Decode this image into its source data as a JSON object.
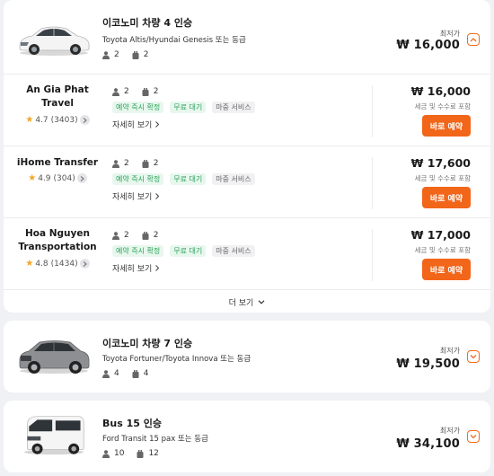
{
  "colors": {
    "accent": "#f2661a",
    "tag_green": "#2aa35a",
    "star": "#f5a623"
  },
  "vehicles": [
    {
      "title": "이코노미 차량 4 인승",
      "models": "Toyota Altis/Hyundai Genesis 또는 동급",
      "passengers": "2",
      "luggage": "2",
      "lowest_label": "최저가",
      "price": "₩ 16,000",
      "expand_icon": "chevron-up-icon"
    },
    {
      "title": "이코노미 차량 7 인승",
      "models": "Toyota Fortuner/Toyota Innova 또는 동급",
      "passengers": "4",
      "luggage": "4",
      "lowest_label": "최저가",
      "price": "₩ 19,500",
      "expand_icon": "chevron-down-icon"
    },
    {
      "title": "Bus 15 인승",
      "models": "Ford Transit 15 pax 또는 동급",
      "passengers": "10",
      "luggage": "12",
      "lowest_label": "최저가",
      "price": "₩ 34,100",
      "expand_icon": "chevron-down-icon"
    }
  ],
  "providers": [
    {
      "name": "An Gia Phat Travel",
      "rating": "4.7",
      "reviews": "(3403)",
      "passengers": "2",
      "luggage": "2",
      "tags": [
        "예약 즉시 확정",
        "무료 대기",
        "마중 서비스"
      ],
      "details": "자세히 보기",
      "price": "₩ 16,000",
      "tax_note": "세금 및 수수료 포함",
      "book": "바로 예약"
    },
    {
      "name": "iHome Transfer",
      "rating": "4.9",
      "reviews": "(304)",
      "passengers": "2",
      "luggage": "2",
      "tags": [
        "예약 즉시 확정",
        "무료 대기",
        "마중 서비스"
      ],
      "details": "자세히 보기",
      "price": "₩ 17,600",
      "tax_note": "세금 및 수수료 포함",
      "book": "바로 예약"
    },
    {
      "name": "Hoa Nguyen Transportation",
      "rating": "4.8",
      "reviews": "(1434)",
      "passengers": "2",
      "luggage": "2",
      "tags": [
        "예약 즉시 확정",
        "무료 대기",
        "마중 서비스"
      ],
      "details": "자세히 보기",
      "price": "₩ 17,000",
      "tax_note": "세금 및 수수료 포함",
      "book": "바로 예약"
    }
  ],
  "more_label": "더 보기"
}
